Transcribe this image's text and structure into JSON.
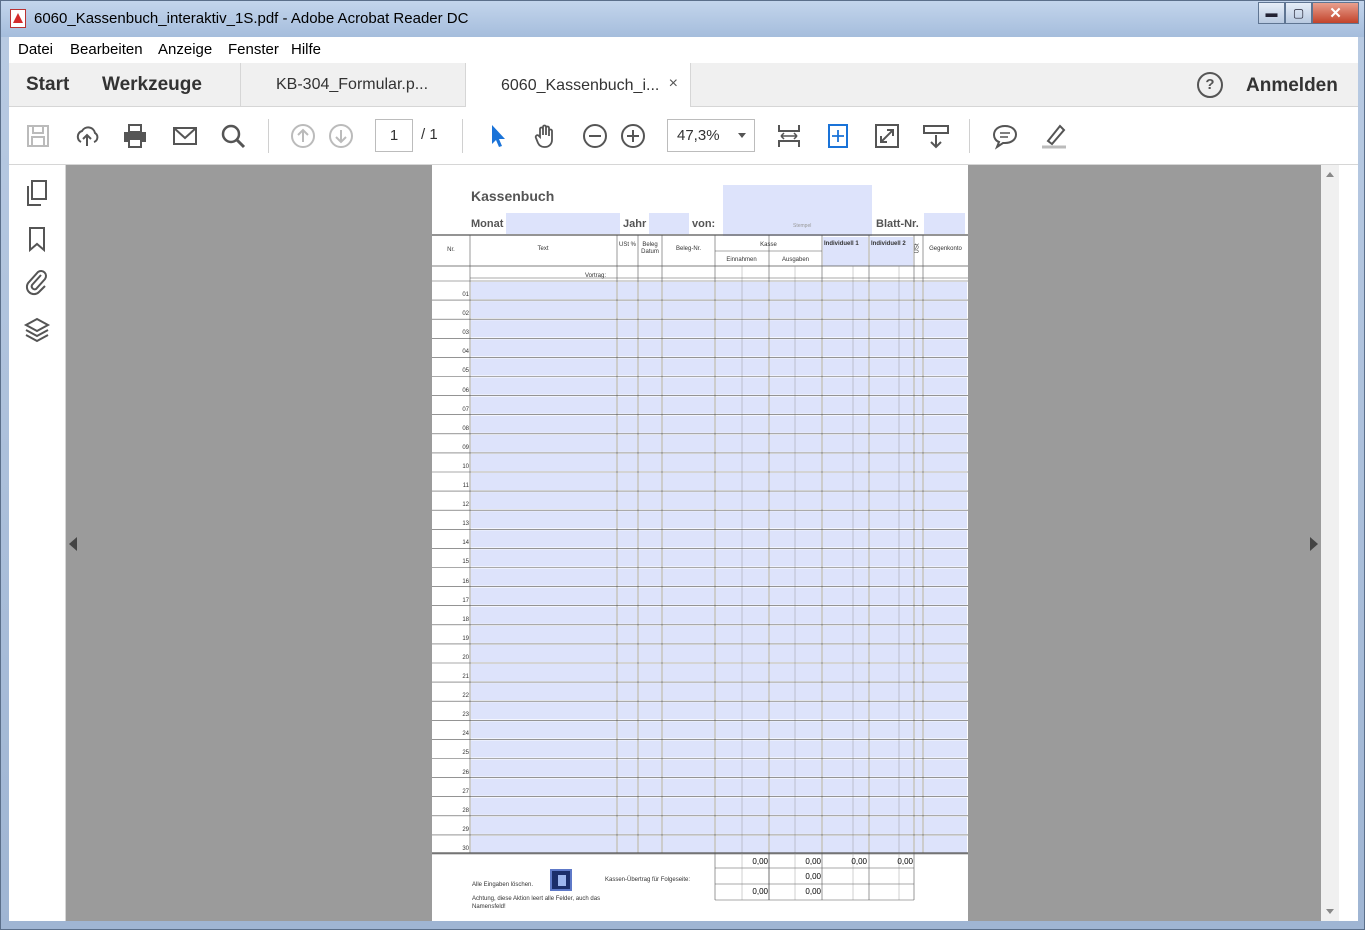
{
  "window": {
    "title": "6060_Kassenbuch_interaktiv_1S.pdf - Adobe Acrobat Reader DC",
    "min": "▬",
    "max": "▢",
    "close": "✕"
  },
  "menu": [
    "Datei",
    "Bearbeiten",
    "Anzeige",
    "Fenster",
    "Hilfe"
  ],
  "nav": {
    "start": "Start",
    "tools": "Werkzeuge",
    "tabs": [
      {
        "label": "KB-304_Formular.p..."
      },
      {
        "label": "6060_Kassenbuch_i...",
        "close": "×"
      }
    ],
    "help": "?",
    "login": "Anmelden"
  },
  "toolbar": {
    "page_current": "1",
    "page_total": "/ 1",
    "zoom": "47,3%"
  },
  "form": {
    "title": "Kassenbuch",
    "monat": "Monat",
    "jahr": "Jahr",
    "von": "von:",
    "blatt": "Blatt-Nr.",
    "stempel": "Stempel",
    "headers": {
      "nr": "Nr.",
      "text": "Text",
      "ust": "USt %",
      "beleg_datum": "Beleg Datum",
      "beleg_nr": "Beleg-Nr.",
      "kasse": "Kasse",
      "einnahmen": "Einnahmen",
      "ausgaben": "Ausgaben",
      "indiv1": "Individuell 1",
      "indiv2": "Individuell 2",
      "ust2": "USt",
      "gegenkonto": "Gegenkonto"
    },
    "vortrag": "Vortrag:",
    "rows": [
      "01",
      "02",
      "03",
      "04",
      "05",
      "06",
      "07",
      "08",
      "09",
      "10",
      "11",
      "12",
      "13",
      "14",
      "15",
      "16",
      "17",
      "18",
      "19",
      "20",
      "21",
      "22",
      "23",
      "24",
      "25",
      "26",
      "27",
      "28",
      "29",
      "30"
    ],
    "footer": {
      "delete_label": "Alle Eingaben löschen.",
      "warning": "Achtung, diese Aktion leert alle Felder, auch das Namensfeld!",
      "uebertrag": "Kassen-Übertrag für Folgeseite:",
      "sum_row1": [
        "0,00",
        "0,00",
        "0,00",
        "0,00"
      ],
      "sum_row2": [
        "0,00"
      ],
      "sum_row3": [
        "0,00",
        "0,00"
      ]
    }
  }
}
